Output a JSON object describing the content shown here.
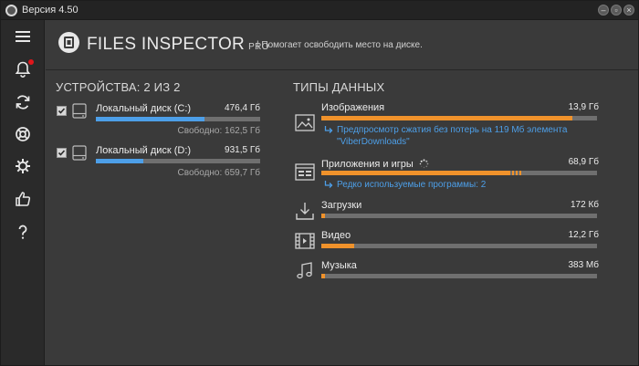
{
  "window": {
    "title": "Версия 4.50",
    "minimize_label": "–",
    "maximize_label": "▫",
    "close_label": "×"
  },
  "sidebar": {
    "items": [
      {
        "name": "menu",
        "icon": "hamburger-icon"
      },
      {
        "name": "notifications",
        "icon": "bell-icon",
        "has_badge": true
      },
      {
        "name": "refresh",
        "icon": "refresh-icon"
      },
      {
        "name": "support",
        "icon": "lifebuoy-icon"
      },
      {
        "name": "settings",
        "icon": "gear-icon"
      },
      {
        "name": "like",
        "icon": "thumbs-up-icon"
      },
      {
        "name": "help",
        "icon": "question-icon"
      }
    ],
    "badge_color": "#e0161b"
  },
  "header": {
    "brand": "FILES INSPECTOR",
    "pro": "PRO",
    "tagline": "| Помогает освободить место на диске."
  },
  "devices": {
    "title": "УСТРОЙСТВА: 2 ИЗ 2",
    "items": [
      {
        "name": "Локальный диск (C:)",
        "size": "476,4 Гб",
        "free": "Свободно: 162,5 Гб",
        "checked": true,
        "used_fraction": 0.66
      },
      {
        "name": "Локальный диск (D:)",
        "size": "931,5 Гб",
        "free": "Свободно: 659,7 Гб",
        "checked": true,
        "used_fraction": 0.29
      }
    ]
  },
  "types": {
    "title": "ТИПЫ ДАННЫХ",
    "items": [
      {
        "name": "Изображения",
        "size": "13,9 Гб",
        "icon": "image-icon",
        "fraction": 0.91,
        "hint": "Предпросмотр сжатия без потерь на 119 Мб элемента \"ViberDownloads\""
      },
      {
        "name": "Приложения и игры",
        "size": "68,9 Гб",
        "icon": "apps-icon",
        "fraction": 0.72,
        "hint": "Редко используемые программы: 2",
        "loading": true
      },
      {
        "name": "Загрузки",
        "size": "172 Кб",
        "icon": "download-icon",
        "fraction": 0.01
      },
      {
        "name": "Видео",
        "size": "12,2 Гб",
        "icon": "film-icon",
        "fraction": 0.12
      },
      {
        "name": "Музыка",
        "size": "383 Мб",
        "icon": "music-icon",
        "fraction": 0.01
      }
    ]
  },
  "colors": {
    "accent_blue": "#4d9fe8",
    "accent_orange": "#f0922b",
    "bar_track": "#6f6f6f",
    "background": "#3a3a3a"
  }
}
